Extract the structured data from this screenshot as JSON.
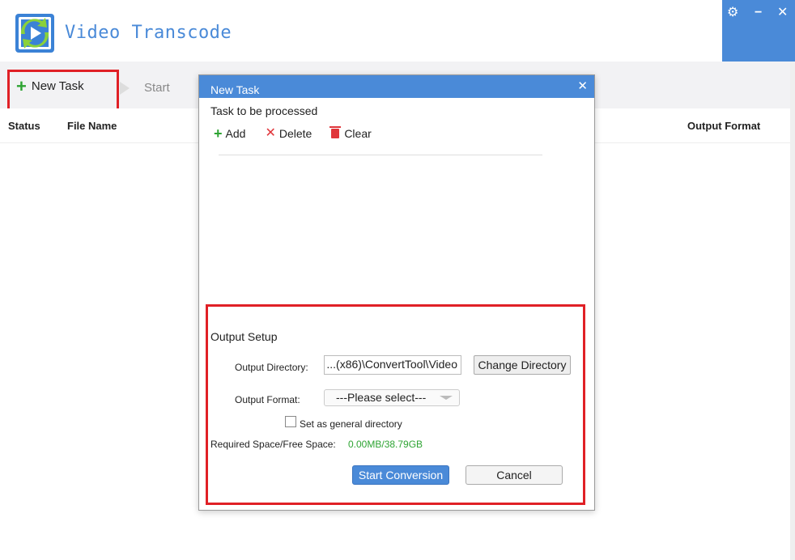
{
  "app": {
    "title": "Video Transcode",
    "accent_color": "#4a8ad8",
    "window_controls": [
      "gear-icon",
      "minimize-icon",
      "close-icon"
    ]
  },
  "toolbar": {
    "new_task_label": "New Task",
    "start_label": "Start"
  },
  "table": {
    "columns": [
      "Status",
      "File Name",
      "Output Format"
    ]
  },
  "dialog": {
    "title": "New Task",
    "task_section_label": "Task to be processed",
    "tools": {
      "add_label": "Add",
      "delete_label": "Delete",
      "clear_label": "Clear"
    },
    "output": {
      "section_title": "Output Setup",
      "directory_label": "Output Directory:",
      "directory_value": "...(x86)\\ConvertTool\\Video",
      "change_directory_label": "Change Directory",
      "format_label": "Output Format:",
      "format_selected": "---Please select---",
      "general_dir_label": "Set as general directory",
      "general_dir_checked": false,
      "space_label": "Required Space/Free Space:",
      "space_value": "0.00MB/38.79GB",
      "start_label": "Start Conversion",
      "cancel_label": "Cancel"
    }
  },
  "colors": {
    "highlight_border": "#e02026",
    "add_green": "#2ea433",
    "delete_red": "#e0353a"
  }
}
